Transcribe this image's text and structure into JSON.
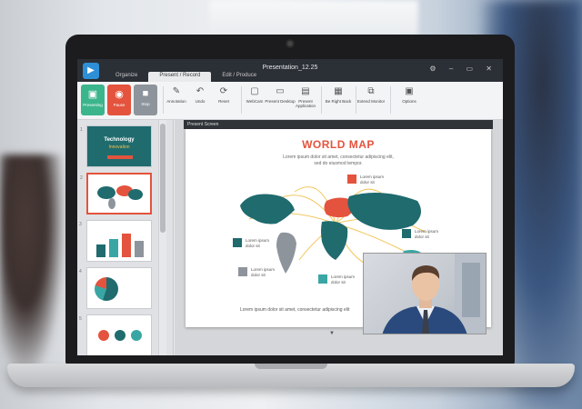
{
  "app": {
    "title": "Presentation_12.25",
    "window_controls": [
      "⚙",
      "–",
      "▭",
      "✕"
    ],
    "icon": "app-logo-icon"
  },
  "tabs": [
    {
      "label": "Organize",
      "active": false
    },
    {
      "label": "Present / Record",
      "active": true
    },
    {
      "label": "Edit / Produce",
      "active": false
    }
  ],
  "ribbon": {
    "big_buttons": [
      {
        "label": "Presenting",
        "icon": "present-icon",
        "color": "#3bb58c"
      },
      {
        "label": "Pause",
        "icon": "pause-icon",
        "color": "#e4533d"
      },
      {
        "label": "Stop",
        "icon": "stop-icon",
        "color": "#8e949c"
      }
    ],
    "tools": [
      {
        "label": "Annotation",
        "icon": "pen-icon"
      },
      {
        "label": "Undo",
        "icon": "undo-icon"
      },
      {
        "label": "Reset",
        "icon": "reset-icon"
      },
      {
        "label": "WebCam",
        "icon": "webcam-icon"
      },
      {
        "label": "Present Desktop",
        "icon": "desktop-icon"
      },
      {
        "label": "Present Application",
        "icon": "application-icon"
      },
      {
        "label": "Be Right Back",
        "icon": "be-right-back-icon"
      },
      {
        "label": "Extend Monitor",
        "icon": "extend-monitor-icon"
      },
      {
        "label": "Options",
        "icon": "options-icon"
      }
    ]
  },
  "slides_rail": {
    "thumbs": [
      {
        "num": "1",
        "title": "Technology",
        "subtitle": "Innovation"
      },
      {
        "num": "2"
      },
      {
        "num": "3"
      },
      {
        "num": "4"
      },
      {
        "num": "5"
      }
    ]
  },
  "present_screen": {
    "label": "Present Screen",
    "slide": {
      "title": "WORLD MAP",
      "subtitle_line1": "Lorem ipsum dolor sit amet, consectetur adipiscing elit,",
      "subtitle_line2": "sed do eiusmod tempor.",
      "footer": "Lorem ipsum dolor sit amet, consectetur adipiscing elit",
      "legend": [
        {
          "text_line1": "Lorem ipsum",
          "text_line2": "dolor sit",
          "color": "#e4533d"
        },
        {
          "text_line1": "Lorem ipsum",
          "text_line2": "dolor sit",
          "color": "#1f6b6e"
        },
        {
          "text_line1": "Lorem ipsum",
          "text_line2": "dolor sit",
          "color": "#1f6b6e"
        },
        {
          "text_line1": "Lorem ipsum",
          "text_line2": "dolor sit",
          "color": "#8e949c"
        },
        {
          "text_line1": "Lorem ipsum",
          "text_line2": "dolor sit",
          "color": "#3aa6a4"
        }
      ]
    }
  },
  "colors": {
    "accent_teal": "#1f6b6e",
    "accent_red": "#e4533d",
    "flight_lines": "#f2c14e",
    "chrome_dark": "#2b2f36"
  }
}
